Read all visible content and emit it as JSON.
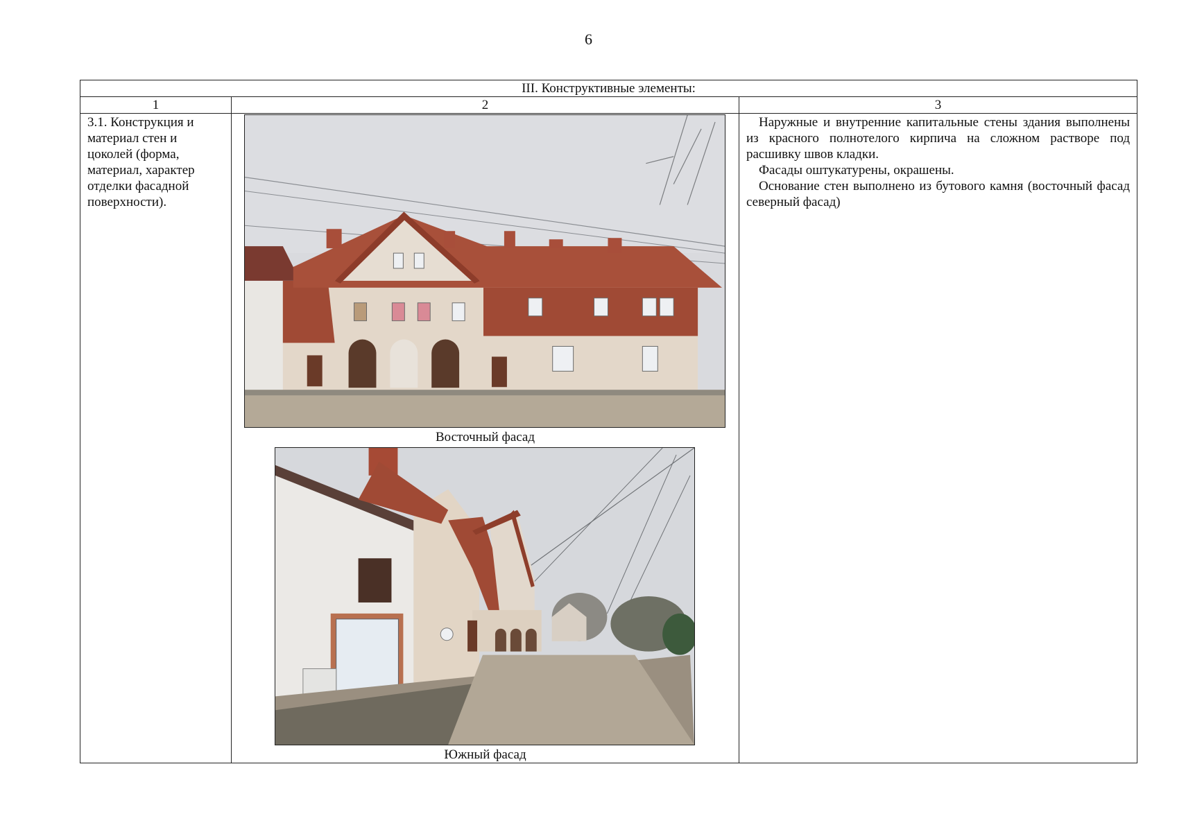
{
  "page": {
    "number": "6"
  },
  "table": {
    "title": "III. Конструктивные элементы:",
    "columns": [
      "1",
      "2",
      "3"
    ],
    "row": {
      "element_text": "3.1. Конструкция и материал стен и цоколей (форма, материал, характер отделки фасадной поверхности).",
      "photos": [
        {
          "caption": "Восточный фасад"
        },
        {
          "caption": "Южный фасад"
        }
      ],
      "description": [
        "Наружные и внутренние капитальные стены здания выполнены из красного полнотелого кирпича на сложном растворе под расшивку швов кладки.",
        "Фасады оштукатурены, окрашены.",
        "Основание стен выполнено из бутового камня (восточный фасад северный фасад)"
      ]
    }
  }
}
